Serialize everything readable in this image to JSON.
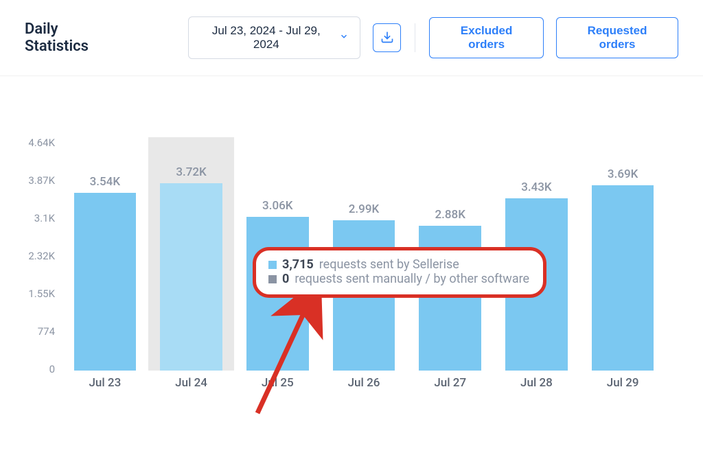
{
  "header": {
    "title": "Daily Statistics",
    "date_range": "Jul 23, 2024 - Jul 29, 2024",
    "excluded_btn": "Excluded orders",
    "requested_btn": "Requested orders"
  },
  "y_ticks": [
    "4.64K",
    "3.87K",
    "3.1K",
    "2.32K",
    "1.55K",
    "774",
    "0"
  ],
  "tooltip": {
    "val1": "3,715",
    "txt1": "requests sent by Sellerise",
    "val2": "0",
    "txt2": "requests sent manually / by other software"
  },
  "chart_data": {
    "type": "bar",
    "categories": [
      "Jul 23",
      "Jul 24",
      "Jul 25",
      "Jul 26",
      "Jul 27",
      "Jul 28",
      "Jul 29"
    ],
    "values": [
      3540,
      3720,
      3060,
      2990,
      2880,
      3430,
      3690
    ],
    "labels": [
      "3.54K",
      "3.72K",
      "3.06K",
      "2.99K",
      "2.88K",
      "3.43K",
      "3.69K"
    ],
    "highlighted_index": 1,
    "tooltip_for_highlighted": {
      "sellerise_requests": 3715,
      "manual_requests": 0
    },
    "ylim": [
      0,
      4640
    ],
    "xlabel": "",
    "ylabel": "",
    "title": "Daily Statistics"
  }
}
